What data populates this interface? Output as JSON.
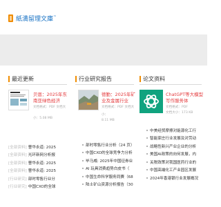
{
  "header": {
    "logo_text": "紙満留理文庫",
    "logo_tm": "™"
  },
  "columns": [
    {
      "title": "最近更新",
      "card": {
        "title": "贝恩：2025年东南亚绿色经济",
        "meta": [
          "文档格式：PDF 文档大",
          "小：5.08 MB"
        ]
      },
      "items": [
        {
          "tag": "[全部资料]",
          "text": "曹华永道: 2025"
        },
        {
          "tag": "[全部资料]",
          "text": "光环新网分析报"
        },
        {
          "tag": "[全部资料]",
          "text": "曹华永道: 2025"
        },
        {
          "tag": "[全部资料]",
          "text": "曹华永道: 2025"
        },
        {
          "tag": "[行业研究]",
          "text": "部时零售行业分"
        },
        {
          "tag": "[行业研究]",
          "text": "中国CXO的全球"
        }
      ]
    },
    {
      "title": "行业研究报告",
      "card": {
        "title": "德勤：2025年矿业及金属行业",
        "meta": [
          "文档格式：PDF 文档大",
          "小：",
          "8.11 MB"
        ]
      },
      "items": [
        {
          "text": "部时零售行业分析（24 页）"
        },
        {
          "text": "中国CXO的全球竞争力分析"
        },
        {
          "text": "毕马威: 2025年中国征券业"
        },
        {
          "text": "AI 玩具消费趋势白皮书（"
        },
        {
          "text": "中国生命科学服务同赛（68"
        },
        {
          "text": "陆士矿山资源分析报告（30"
        }
      ]
    },
    {
      "title": "论文资料",
      "card": {
        "title": "ChatGPT等大模型写作服务体",
        "meta": [
          "文档格式：PDF",
          "文档大小：173 KB"
        ]
      },
      "items": [
        {
          "text": "中美经贸摩擦对能源化工行"
        },
        {
          "text": "智能家庄行业发展及对劳动"
        },
        {
          "text": "战略性新兴产业企业的分析"
        },
        {
          "text": "美国AI政策的向何发展，内"
        },
        {
          "text": "关税政策对我国医药行业的"
        },
        {
          "text": "中国高端化工产业园区发展"
        },
        {
          "text": "2024年香港银行业发展概况"
        }
      ]
    }
  ]
}
